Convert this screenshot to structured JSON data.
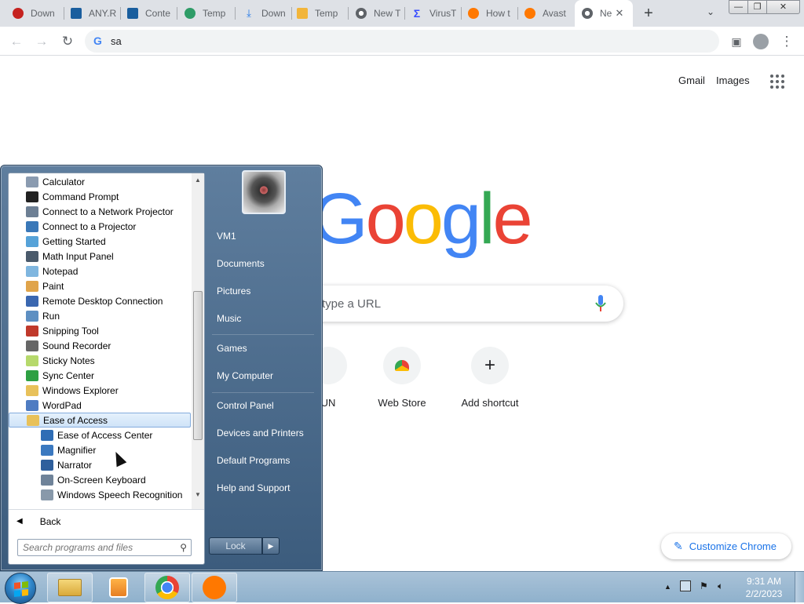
{
  "browser": {
    "tabs": [
      {
        "title": "Down",
        "favicon": "gmail-icon",
        "color": "#c5221f"
      },
      {
        "title": "ANY.R",
        "favicon": "anyrun-icon",
        "color": "#1a5e9e"
      },
      {
        "title": "Conte",
        "favicon": "anyrun-icon",
        "color": "#1a5e9e"
      },
      {
        "title": "Temp",
        "favicon": "temp-mail-icon",
        "color": "#2e9c67"
      },
      {
        "title": "Down",
        "favicon": "download-icon",
        "color": "#1a73e8"
      },
      {
        "title": "Temp",
        "favicon": "temp-mail-icon",
        "color": "#f2b53a"
      },
      {
        "title": "New T",
        "favicon": "chrome-icon",
        "color": "#5f6368"
      },
      {
        "title": "VirusT",
        "favicon": "virustotal-icon",
        "color": "#394eff"
      },
      {
        "title": "How t",
        "favicon": "avast-icon",
        "color": "#ff7800"
      },
      {
        "title": "Avast",
        "favicon": "avast-icon",
        "color": "#ff7800"
      },
      {
        "title": "Ne",
        "favicon": "chrome-icon",
        "color": "#5f6368",
        "active": true
      }
    ],
    "new_tab_label": "+",
    "close_tab_label": "✕",
    "tab_search_label": "⌄",
    "window": {
      "minimize": "—",
      "restore": "❐",
      "close": "✕"
    },
    "address_bar_value": "sa",
    "address_g": "G"
  },
  "newtab": {
    "gmail": "Gmail",
    "images": "Images",
    "logo_letters": [
      {
        "ch": "G",
        "color": "#4285f4"
      },
      {
        "ch": "o",
        "color": "#ea4335"
      },
      {
        "ch": "o",
        "color": "#fbbc05"
      },
      {
        "ch": "g",
        "color": "#4285f4"
      },
      {
        "ch": "l",
        "color": "#34a853"
      },
      {
        "ch": "e",
        "color": "#ea4335"
      }
    ],
    "search_placeholder": "type a URL",
    "shortcuts": [
      {
        "label": "UN",
        "icon": "anyrun-shortcut-icon"
      },
      {
        "label": "Web Store",
        "icon": "webstore-icon"
      },
      {
        "label": "Add shortcut",
        "icon": "plus-icon",
        "glyph": "+"
      }
    ],
    "customize_label": "Customize Chrome",
    "customize_icon": "✎"
  },
  "start_menu": {
    "programs": [
      {
        "label": "Calculator",
        "icon": "calculator-icon",
        "color": "#8a9bb0",
        "sub": false
      },
      {
        "label": "Command Prompt",
        "icon": "cmd-icon",
        "color": "#222222",
        "sub": false
      },
      {
        "label": "Connect to a Network Projector",
        "icon": "network-projector-icon",
        "color": "#6d7f94",
        "sub": false
      },
      {
        "label": "Connect to a Projector",
        "icon": "projector-icon",
        "color": "#3a78b8",
        "sub": false
      },
      {
        "label": "Getting Started",
        "icon": "getting-started-icon",
        "color": "#56a2d8",
        "sub": false
      },
      {
        "label": "Math Input Panel",
        "icon": "math-input-icon",
        "color": "#4a5a6b",
        "sub": false
      },
      {
        "label": "Notepad",
        "icon": "notepad-icon",
        "color": "#7fb6df",
        "sub": false
      },
      {
        "label": "Paint",
        "icon": "paint-icon",
        "color": "#e0a44a",
        "sub": false
      },
      {
        "label": "Remote Desktop Connection",
        "icon": "remote-desktop-icon",
        "color": "#3a67b0",
        "sub": false
      },
      {
        "label": "Run",
        "icon": "run-icon",
        "color": "#5d8fc2",
        "sub": false
      },
      {
        "label": "Snipping Tool",
        "icon": "scissors-icon",
        "color": "#c0392b",
        "sub": false
      },
      {
        "label": "Sound Recorder",
        "icon": "microphone-icon",
        "color": "#666666",
        "sub": false
      },
      {
        "label": "Sticky Notes",
        "icon": "sticky-notes-icon",
        "color": "#b6d96c",
        "sub": false
      },
      {
        "label": "Sync Center",
        "icon": "sync-center-icon",
        "color": "#2ea043",
        "sub": false
      },
      {
        "label": "Windows Explorer",
        "icon": "folder-icon",
        "color": "#e8c15a",
        "sub": false
      },
      {
        "label": "WordPad",
        "icon": "wordpad-icon",
        "color": "#4f7cc2",
        "sub": false
      },
      {
        "label": "Ease of Access",
        "icon": "folder-icon",
        "color": "#e8c15a",
        "sub": false,
        "selected": true
      },
      {
        "label": "Ease of Access Center",
        "icon": "ease-of-access-icon",
        "color": "#2f6db5",
        "sub": true
      },
      {
        "label": "Magnifier",
        "icon": "magnifier-icon",
        "color": "#3b79c0",
        "sub": true
      },
      {
        "label": "Narrator",
        "icon": "narrator-icon",
        "color": "#2f5f9c",
        "sub": true
      },
      {
        "label": "On-Screen Keyboard",
        "icon": "keyboard-icon",
        "color": "#6f8399",
        "sub": true
      },
      {
        "label": "Windows Speech Recognition",
        "icon": "speech-icon",
        "color": "#8899aa",
        "sub": true
      }
    ],
    "back_label": "Back",
    "back_arrow": "◀",
    "search_placeholder": "Search programs and files",
    "search_icon": "⚲",
    "right_links": [
      {
        "label": "VM1"
      },
      {
        "label": "Documents"
      },
      {
        "label": "Pictures"
      },
      {
        "label": "Music"
      },
      {
        "label": "Games"
      },
      {
        "label": "My Computer"
      },
      {
        "label": "Control Panel"
      },
      {
        "label": "Devices and Printers"
      },
      {
        "label": "Default Programs"
      },
      {
        "label": "Help and Support"
      }
    ],
    "lock_label": "Lock",
    "lock_arrow": "▶"
  },
  "taskbar": {
    "apps": [
      {
        "name": "explorer",
        "icon": "folder-icon"
      },
      {
        "name": "media-player",
        "icon": "media-player-icon"
      },
      {
        "name": "chrome",
        "icon": "chrome-icon"
      },
      {
        "name": "avast",
        "icon": "avast-icon"
      }
    ],
    "tray_arrow": "▲",
    "time": "9:31 AM",
    "date": "2/2/2023"
  }
}
